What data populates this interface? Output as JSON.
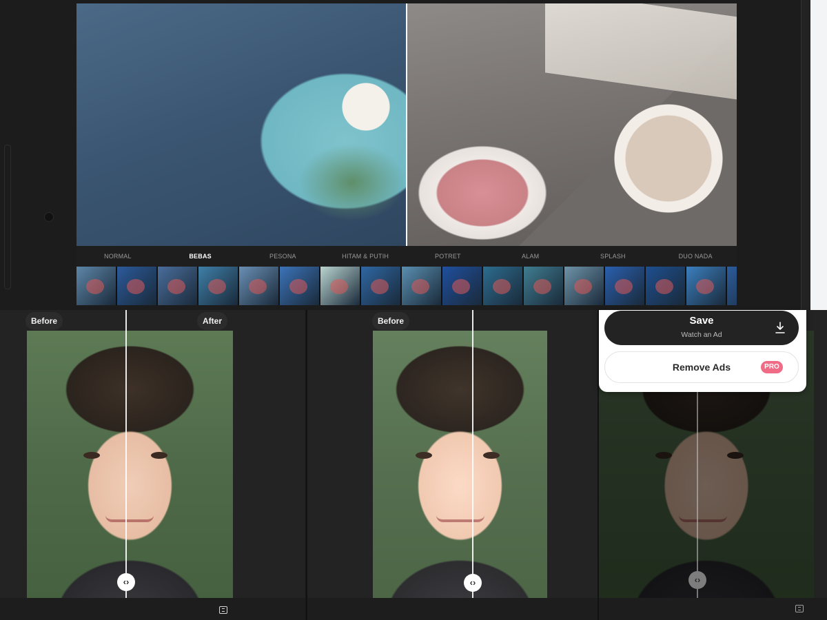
{
  "editor": {
    "filter_tabs": [
      {
        "label": "NORMAL",
        "active": false
      },
      {
        "label": "BEBAS",
        "active": true
      },
      {
        "label": "PESONA",
        "active": false
      },
      {
        "label": "HITAM & PUTIH",
        "active": false
      },
      {
        "label": "POTRET",
        "active": false
      },
      {
        "label": "ALAM",
        "active": false
      },
      {
        "label": "SPLASH",
        "active": false
      },
      {
        "label": "DUO NADA",
        "active": false
      }
    ],
    "thumbnail_tints": [
      "#5e86a8",
      "#2b5a9a",
      "#4a6d9b",
      "#3f7fa8",
      "#6a8fb4",
      "#3b73b8",
      "#b9d4cf",
      "#2f67a3",
      "#5a8fb0",
      "#1f4f9e",
      "#2d6d8f",
      "#3f7d90",
      "#6f93a8",
      "#2a5fae",
      "#1e4f8f",
      "#3b7fbf",
      "#2c5c9c"
    ]
  },
  "comparison_panels": [
    {
      "before_label": "Before",
      "after_label": "After"
    },
    {
      "before_label": "Before"
    }
  ],
  "save_dialog": {
    "save_label": "Save",
    "save_sublabel": "Watch an Ad",
    "remove_ads_label": "Remove Ads",
    "pro_badge": "PRO"
  },
  "colors": {
    "active_tab": "#ffffff",
    "pro_badge": "#f06b86",
    "save_button": "#232323"
  }
}
